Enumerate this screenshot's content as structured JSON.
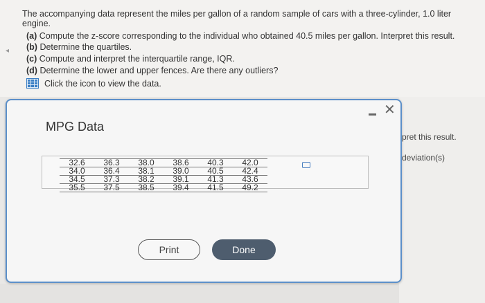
{
  "question": {
    "intro": "The accompanying data represent the miles per gallon of a random sample of cars with a three-cylinder, 1.0 liter engine.",
    "parts": [
      {
        "label": "(a)",
        "text": "Compute the z-score corresponding to the individual who obtained 40.5 miles per gallon. Interpret this result."
      },
      {
        "label": "(b)",
        "text": "Determine the quartiles."
      },
      {
        "label": "(c)",
        "text": "Compute and interpret the interquartile range, IQR."
      },
      {
        "label": "(d)",
        "text": "Determine the lower and upper fences. Are there any outliers?"
      }
    ],
    "data_link": "Click the icon to view the data."
  },
  "background_right": {
    "line1": "pret this result.",
    "line2": "deviation(s)"
  },
  "dialog": {
    "title": "MPG Data",
    "rows": [
      [
        "32.6",
        "36.3",
        "38.0",
        "38.6",
        "40.3",
        "42.0"
      ],
      [
        "34.0",
        "36.4",
        "38.1",
        "39.0",
        "40.5",
        "42.4"
      ],
      [
        "34.5",
        "37.3",
        "38.2",
        "39.1",
        "41.3",
        "43.6"
      ],
      [
        "35.5",
        "37.5",
        "38.5",
        "39.4",
        "41.5",
        "49.2"
      ]
    ],
    "print_label": "Print",
    "done_label": "Done"
  },
  "colors": {
    "accent": "#5b8fc9",
    "done_button": "#4e5d6e"
  }
}
